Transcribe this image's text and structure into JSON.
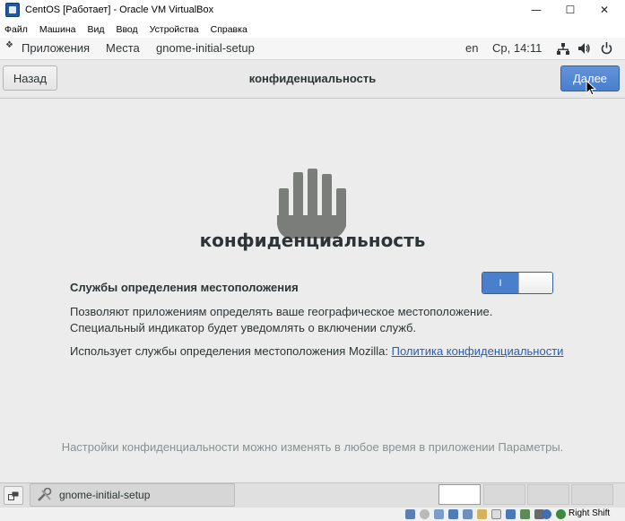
{
  "host_window": {
    "title": "CentOS [Работает] - Oracle VM VirtualBox",
    "controls": {
      "minimize": "—",
      "maximize": "☐",
      "close": "✕"
    }
  },
  "host_menu": [
    "Файл",
    "Машина",
    "Вид",
    "Ввод",
    "Устройства",
    "Справка"
  ],
  "gnome_topbar": {
    "applications": "Приложения",
    "places": "Места",
    "app_name": "gnome-initial-setup",
    "keyboard_layout": "en",
    "clock": "Ср, 14:11"
  },
  "header": {
    "back_label": "Назад",
    "title": "конфиденциальность",
    "next_label": "Далее"
  },
  "page": {
    "heading": "конфиденциальность",
    "location_title": "Службы определения местоположения",
    "location_toggle_on_label": "I",
    "location_enabled": true,
    "description_line1": "Позволяют приложениям определять ваше географическое местоположение.",
    "description_line2": "Специальный индикатор будет уведомлять о включении служб.",
    "mozilla_text": "Использует службы определения местоположения Mozilla: ",
    "privacy_link": "Политика конфиденциальности",
    "footer_note": "Настройки конфиденциальности можно изменять в любое время в приложении Параметры."
  },
  "taskbar": {
    "task_label": "gnome-initial-setup",
    "workspaces": 4,
    "active_workspace": 1
  },
  "statusbar": {
    "host_key": "Right Shift"
  },
  "colors": {
    "accent": "#4a7fcc",
    "link": "#2a5db0",
    "background": "#ececec"
  }
}
